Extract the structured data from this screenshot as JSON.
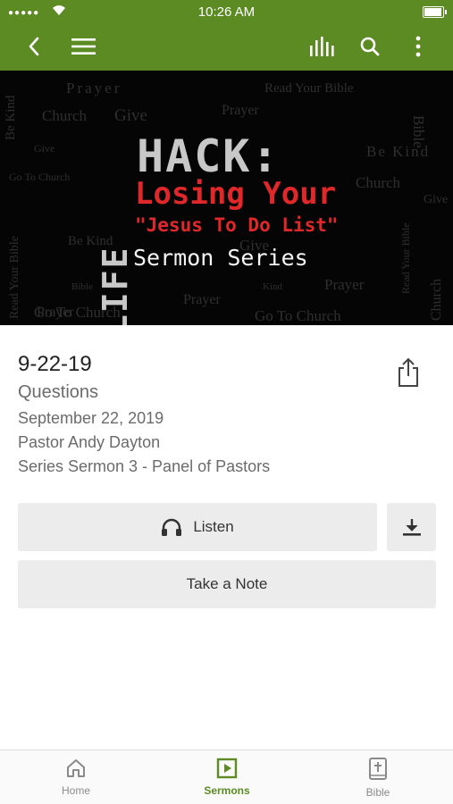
{
  "status_bar": {
    "time": "10:26 AM",
    "signal_dots": "●●●●●"
  },
  "banner": {
    "title_word": "HACK:",
    "vertical_word": "LIFE",
    "line1": "Losing Your",
    "line2": "\"Jesus To Do List\"",
    "line3": "Sermon Series",
    "background_words": [
      "Prayer",
      "Read Your Bible",
      "Be Kind",
      "Church",
      "Give",
      "Prayer",
      "Be Kind",
      "Give",
      "Go To Church",
      "Church",
      "Be Kind",
      "Give",
      "Prayer",
      "Bible",
      "Prayer",
      "Kind",
      "Prayer",
      "Go To Church",
      "Go To Church",
      "Read Your Bible",
      "Church",
      "Bible",
      "Give",
      "Read Your Bible"
    ]
  },
  "sermon": {
    "title": "9-22-19",
    "subtitle": "Questions",
    "date": "September 22, 2019",
    "speaker": "Pastor Andy Dayton",
    "series": "Series Sermon 3 - Panel of Pastors"
  },
  "actions": {
    "listen_label": "Listen",
    "note_label": "Take a Note"
  },
  "tabs": [
    {
      "label": "Home",
      "icon": "home-icon"
    },
    {
      "label": "Sermons",
      "icon": "play-square-icon"
    },
    {
      "label": "Bible",
      "icon": "bible-icon"
    }
  ],
  "colors": {
    "brand_green": "#5b8b22",
    "banner_red": "#e0282a"
  }
}
